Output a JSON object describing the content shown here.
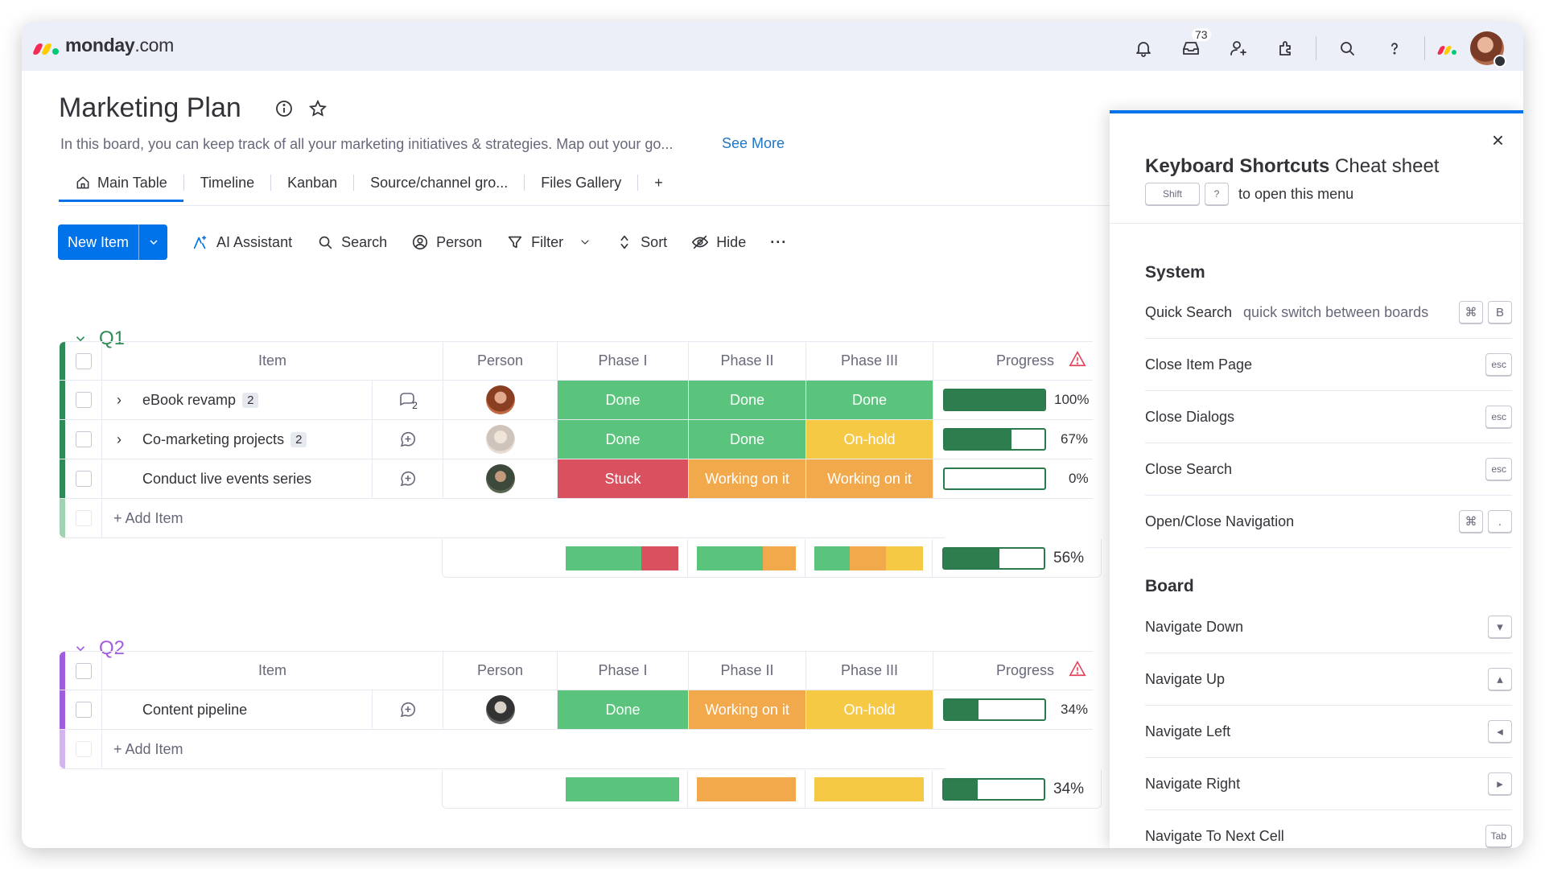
{
  "app": {
    "logo_text_bold": "monday",
    "logo_text_light": ".com",
    "logo_colors": [
      "#f62b54",
      "#ffcc00",
      "#00ca72"
    ],
    "inbox_count": "73",
    "top_icons": [
      "bell-icon",
      "inbox-icon",
      "invite-members-icon",
      "apps-icon",
      "search-icon",
      "help-icon"
    ]
  },
  "board": {
    "title": "Marketing Plan",
    "description": "In this board, you can keep track of all your marketing initiatives & strategies. Map out your go...",
    "see_more": "See More",
    "tabs": [
      "Main Table",
      "Timeline",
      "Kanban",
      "Source/channel gro...",
      "Files Gallery"
    ],
    "add_tab": "+"
  },
  "toolbar": {
    "new_item": "New Item",
    "ai_assistant": "AI Assistant",
    "search": "Search",
    "person": "Person",
    "filter": "Filter",
    "sort": "Sort",
    "hide": "Hide",
    "more": "···"
  },
  "columns": {
    "item": "Item",
    "person": "Person",
    "phase1": "Phase I",
    "phase2": "Phase II",
    "phase3": "Phase III",
    "progress": "Progress"
  },
  "status_colors": {
    "Done": "#5ac47d",
    "Stuck": "#d9505f",
    "Working on it": "#f1a94c",
    "On-hold": "#f6c944"
  },
  "groups": [
    {
      "name": "Q1",
      "color": "#2e8b57",
      "add_item": "+ Add Item",
      "items": [
        {
          "name": "eBook revamp",
          "subitems": "2",
          "expandable": true,
          "updates": "2",
          "phase1": "Done",
          "phase2": "Done",
          "phase3": "Done",
          "progress": 100,
          "progress_label": "100%"
        },
        {
          "name": "Co-marketing projects",
          "subitems": "2",
          "expandable": true,
          "updates": "",
          "phase1": "Done",
          "phase2": "Done",
          "phase3": "On-hold",
          "progress": 67,
          "progress_label": "67%"
        },
        {
          "name": "Conduct live events series",
          "subitems": "",
          "expandable": false,
          "updates": "",
          "phase1": "Stuck",
          "phase2": "Working on it",
          "phase3": "Working on it",
          "progress": 0,
          "progress_label": "0%"
        }
      ],
      "summary": {
        "phase1": [
          {
            "status": "Done",
            "share": 0.67
          },
          {
            "status": "Stuck",
            "share": 0.33
          }
        ],
        "phase2": [
          {
            "status": "Done",
            "share": 0.67
          },
          {
            "status": "Working on it",
            "share": 0.33
          }
        ],
        "phase3": [
          {
            "status": "Done",
            "share": 0.33
          },
          {
            "status": "Working on it",
            "share": 0.33
          },
          {
            "status": "On-hold",
            "share": 0.34
          }
        ],
        "progress": 56,
        "progress_label": "56%"
      }
    },
    {
      "name": "Q2",
      "color": "#a25ddc",
      "add_item": "+ Add Item",
      "items": [
        {
          "name": "Content pipeline",
          "subitems": "",
          "expandable": false,
          "updates": "",
          "phase1": "Done",
          "phase2": "Working on it",
          "phase3": "On-hold",
          "progress": 34,
          "progress_label": "34%"
        }
      ],
      "summary": {
        "phase1": [
          {
            "status": "Done",
            "share": 1
          }
        ],
        "phase2": [
          {
            "status": "Working on it",
            "share": 1
          }
        ],
        "phase3": [
          {
            "status": "On-hold",
            "share": 1
          }
        ],
        "progress": 34,
        "progress_label": "34%"
      }
    }
  ],
  "shortcuts_panel": {
    "title_bold": "Keyboard Shortcuts",
    "title_rest": " Cheat sheet",
    "hint_key1": "Shift",
    "hint_key2": "?",
    "hint_text": "to open this menu",
    "close": "×",
    "sections": [
      {
        "title": "System",
        "rows": [
          {
            "name": "Quick Search",
            "desc": "quick switch between boards",
            "keys": [
              "⌘",
              "B"
            ]
          },
          {
            "name": "Close Item Page",
            "desc": "",
            "keys": [
              "esc"
            ]
          },
          {
            "name": "Close Dialogs",
            "desc": "",
            "keys": [
              "esc"
            ]
          },
          {
            "name": "Close Search",
            "desc": "",
            "keys": [
              "esc"
            ]
          },
          {
            "name": "Open/Close Navigation",
            "desc": "",
            "keys": [
              "⌘",
              "."
            ]
          }
        ]
      },
      {
        "title": "Board",
        "rows": [
          {
            "name": "Navigate Down",
            "desc": "",
            "keys": [
              "▾"
            ]
          },
          {
            "name": "Navigate Up",
            "desc": "",
            "keys": [
              "▴"
            ]
          },
          {
            "name": "Navigate Left",
            "desc": "",
            "keys": [
              "◂"
            ]
          },
          {
            "name": "Navigate Right",
            "desc": "",
            "keys": [
              "▸"
            ]
          },
          {
            "name": "Navigate To Next Cell",
            "desc": "",
            "keys": [
              "Tab"
            ]
          }
        ]
      }
    ]
  }
}
